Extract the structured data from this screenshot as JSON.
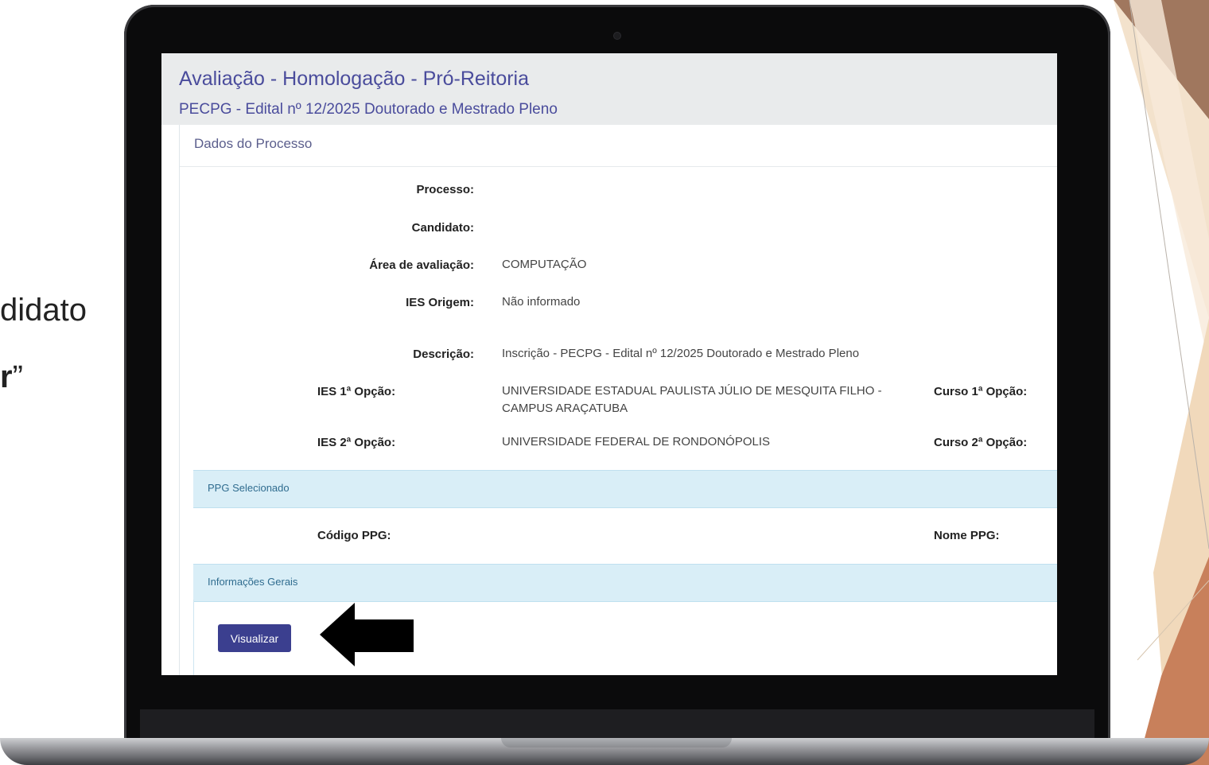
{
  "slide": {
    "line1": "didato",
    "line2_prefix": "",
    "line2_bold": "r",
    "line2_suffix": "”"
  },
  "page": {
    "title": "Avaliação - Homologação - Pró-Reitoria",
    "subtitle": "PECPG - Edital nº 12/2025 Doutorado e Mestrado Pleno"
  },
  "process": {
    "heading": "Dados do Processo",
    "fields": {
      "processo_label": "Processo:",
      "processo_value": "",
      "candidato_label": "Candidato:",
      "candidato_value": "",
      "area_label": "Área de avaliação:",
      "area_value": "COMPUTAÇÃO",
      "ies_origem_label": "IES Origem:",
      "ies_origem_value": "Não informado",
      "descricao_label": "Descrição:",
      "descricao_value": "Inscrição - PECPG - Edital nº 12/2025 Doutorado e Mestrado Pleno",
      "ies1_label": "IES 1ª Opção:",
      "ies1_value_line1": "UNIVERSIDADE ESTADUAL PAULISTA JÚLIO DE MESQUITA FILHO -",
      "ies1_value_line2": "CAMPUS ARAÇATUBA",
      "curso1_label": "Curso 1ª Opção:",
      "ies2_label": "IES 2ª Opção:",
      "ies2_value": "UNIVERSIDADE FEDERAL DE RONDONÓPOLIS",
      "curso2_label": "Curso 2ª Opção:"
    }
  },
  "ppg": {
    "section_title": "PPG Selecionado",
    "codigo_label": "Código PPG:",
    "nome_label": "Nome PPG:"
  },
  "info": {
    "section_title": "Informações Gerais",
    "view_button": "Visualizar"
  },
  "colors": {
    "title": "#4a4c9c",
    "button": "#3b3f8f",
    "section_bar": "#d9eef7"
  }
}
